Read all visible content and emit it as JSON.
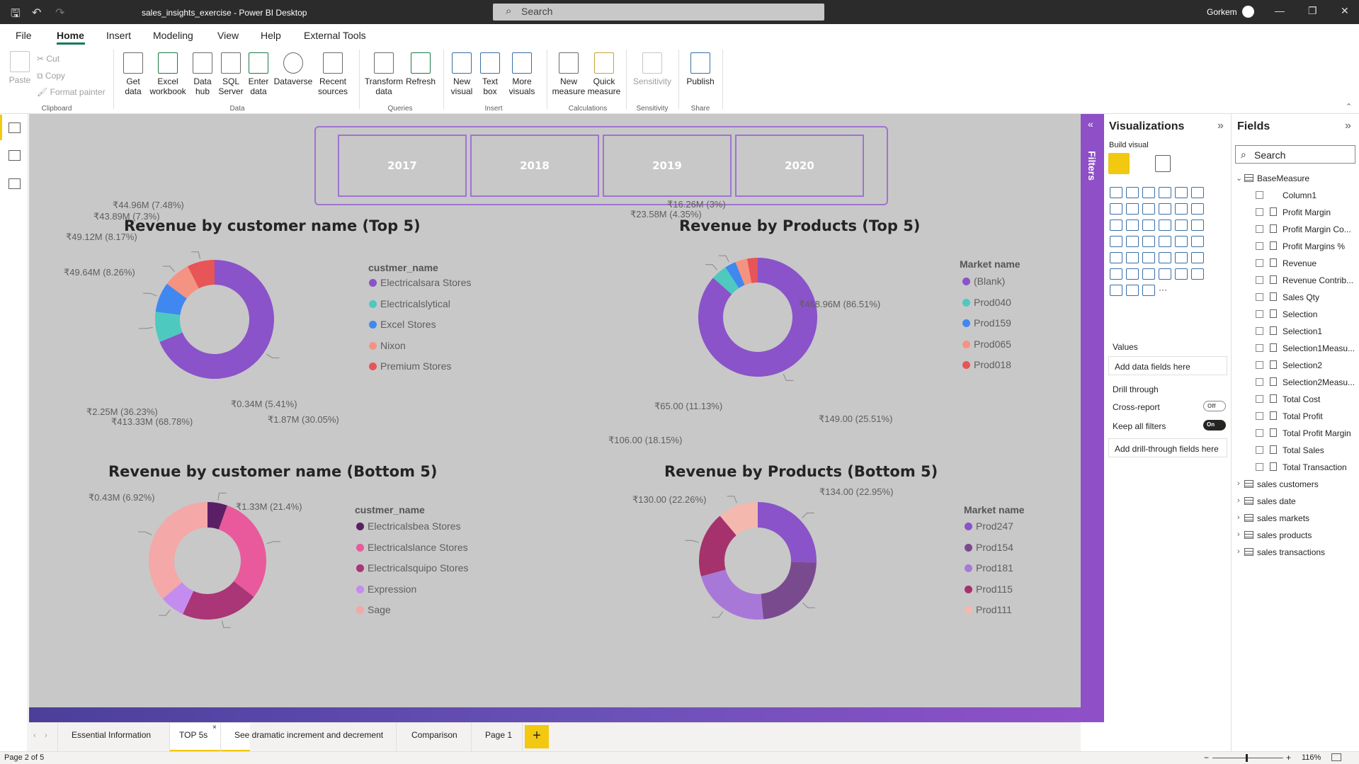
{
  "titlebar": {
    "title": "sales_insights_exercise - Power BI Desktop",
    "search_placeholder": "Search",
    "user": "Gorkem"
  },
  "menu": [
    "File",
    "Home",
    "Insert",
    "Modeling",
    "View",
    "Help",
    "External Tools"
  ],
  "ribbon": {
    "clipboard": {
      "paste": "Paste",
      "cut": "Cut",
      "copy": "Copy",
      "format_painter": "Format painter",
      "group": "Clipboard"
    },
    "data": {
      "get_data": "Get data",
      "excel": "Excel workbook",
      "data_hub": "Data hub",
      "sql": "SQL Server",
      "enter": "Enter data",
      "dataverse": "Dataverse",
      "recent": "Recent sources",
      "group": "Data"
    },
    "queries": {
      "transform": "Transform data",
      "refresh": "Refresh",
      "group": "Queries"
    },
    "insert": {
      "new_visual": "New visual",
      "text_box": "Text box",
      "more_visuals": "More visuals",
      "group": "Insert"
    },
    "calculations": {
      "new_measure": "New measure",
      "quick_measure": "Quick measure",
      "group": "Calculations"
    },
    "sensitivity": {
      "sensitivity": "Sensitivity",
      "group": "Sensitivity"
    },
    "share": {
      "publish": "Publish",
      "group": "Share"
    }
  },
  "slicer": [
    "2017",
    "2018",
    "2019",
    "2020"
  ],
  "charts": {
    "c1": {
      "title": "Revenue by customer name (Top 5)",
      "legend_title": "custmer_name"
    },
    "c2": {
      "title": "Revenue by Products (Top 5)",
      "legend_title": "Market name"
    },
    "c3": {
      "title": "Revenue by customer name (Bottom 5)",
      "legend_title": "custmer_name"
    },
    "c4": {
      "title": "Revenue by Products (Bottom 5)",
      "legend_title": "Market name"
    }
  },
  "chart_data": [
    {
      "type": "pie",
      "title": "Revenue by customer name (Top 5)",
      "legend_title": "custmer_name",
      "slices": [
        {
          "label": "Electricalsara Stores",
          "value": 413.33,
          "text": "₹413.33M (68.78%)",
          "color": "#8a53c9"
        },
        {
          "label": "Electricalslytical",
          "value": 49.64,
          "text": "₹49.64M (8.26%)",
          "color": "#4ec9c0"
        },
        {
          "label": "Excel Stores",
          "value": 49.12,
          "text": "₹49.12M (8.17%)",
          "color": "#3f88f0"
        },
        {
          "label": "Nixon",
          "value": 43.89,
          "text": "₹43.89M (7.3%)",
          "color": "#f59382"
        },
        {
          "label": "Premium Stores",
          "value": 44.96,
          "text": "₹44.96M (7.48%)",
          "color": "#e75556"
        }
      ]
    },
    {
      "type": "pie",
      "title": "Revenue by Products (Top 5)",
      "legend_title": "Market name",
      "slices": [
        {
          "label": "(Blank)",
          "value": 468.96,
          "text": "₹468.96M (86.51%)",
          "color": "#8a53c9"
        },
        {
          "label": "Prod040",
          "value": 23.58,
          "text": "₹23.58M (4.35%)",
          "color": "#4ec9c0"
        },
        {
          "label": "Prod159",
          "value": 16.26,
          "text": "₹16.26M (3%)",
          "color": "#3f88f0"
        },
        {
          "label": "Prod065",
          "value": 17.7,
          "text": "",
          "color": "#f59382"
        },
        {
          "label": "Prod018",
          "value": 15.6,
          "text": "",
          "color": "#e75556"
        }
      ]
    },
    {
      "type": "pie",
      "title": "Revenue by customer name (Bottom 5)",
      "legend_title": "custmer_name",
      "slices": [
        {
          "label": "Electricalsbea Stores",
          "value": 0.34,
          "text": "₹0.34M (5.41%)",
          "color": "#5b1f66"
        },
        {
          "label": "Electricalslance Stores",
          "value": 1.87,
          "text": "₹1.87M (30.05%)",
          "color": "#e85a9b"
        },
        {
          "label": "Electricalsquipo Stores",
          "value": 1.33,
          "text": "₹1.33M (21.4%)",
          "color": "#aa3577"
        },
        {
          "label": "Expression",
          "value": 0.43,
          "text": "₹0.43M (6.92%)",
          "color": "#c58cf0"
        },
        {
          "label": "Sage",
          "value": 2.25,
          "text": "₹2.25M (36.23%)",
          "color": "#f4a8a8"
        }
      ]
    },
    {
      "type": "pie",
      "title": "Revenue by Products (Bottom 5)",
      "legend_title": "Market name",
      "slices": [
        {
          "label": "Prod247",
          "value": 149.0,
          "text": "₹149.00 (25.51%)",
          "color": "#8a53c9"
        },
        {
          "label": "Prod154",
          "value": 134.0,
          "text": "₹134.00 (22.95%)",
          "color": "#7a4a8f"
        },
        {
          "label": "Prod181",
          "value": 130.0,
          "text": "₹130.00 (22.26%)",
          "color": "#a878d8"
        },
        {
          "label": "Prod115",
          "value": 106.0,
          "text": "₹106.00 (18.15%)",
          "color": "#a5326c"
        },
        {
          "label": "Prod111",
          "value": 65.0,
          "text": "₹65.00 (11.13%)",
          "color": "#f5b8ae"
        }
      ]
    }
  ],
  "visualizations": {
    "title": "Visualizations",
    "build": "Build visual",
    "values": "Values",
    "add_fields": "Add data fields here",
    "drill": "Drill through",
    "cross": "Cross-report",
    "cross_state": "Off",
    "keep": "Keep all filters",
    "keep_state": "On",
    "add_drill": "Add drill-through fields here"
  },
  "filters_label": "Filters",
  "fields": {
    "title": "Fields",
    "search_placeholder": "Search",
    "base": "BaseMeasure",
    "measures": [
      "Column1",
      "Profit Margin",
      "Profit Margin Co...",
      "Profit Margins %",
      "Revenue",
      "Revenue Contrib...",
      "Sales Qty",
      "Selection",
      "Selection1",
      "Selection1Measu...",
      "Selection2",
      "Selection2Measu...",
      "Total Cost",
      "Total Profit",
      "Total Profit Margin",
      "Total Sales",
      "Total Transaction"
    ],
    "tables": [
      "sales customers",
      "sales date",
      "sales markets",
      "sales products",
      "sales transactions"
    ]
  },
  "tabs": [
    "Essential Information",
    "TOP 5s",
    "See dramatic increment and decrement",
    "Comparison",
    "Page 1"
  ],
  "status": {
    "page": "Page 2 of 5",
    "zoom": "116%"
  }
}
